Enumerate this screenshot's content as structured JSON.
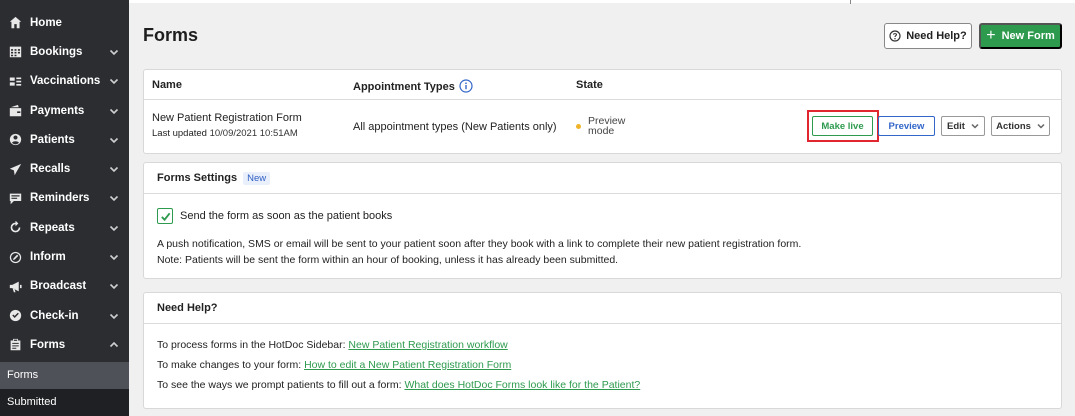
{
  "sidebar": {
    "items": [
      {
        "label": "Home",
        "icon": "home-icon",
        "chevron": false
      },
      {
        "label": "Bookings",
        "icon": "calendar-icon",
        "chevron": "down"
      },
      {
        "label": "Vaccinations",
        "icon": "syringe-icon",
        "chevron": "down"
      },
      {
        "label": "Payments",
        "icon": "wallet-icon",
        "chevron": "down"
      },
      {
        "label": "Patients",
        "icon": "user-circle-icon",
        "chevron": "down"
      },
      {
        "label": "Recalls",
        "icon": "send-icon",
        "chevron": "down"
      },
      {
        "label": "Reminders",
        "icon": "message-icon",
        "chevron": "down"
      },
      {
        "label": "Repeats",
        "icon": "repeat-icon",
        "chevron": "down"
      },
      {
        "label": "Inform",
        "icon": "pen-circle-icon",
        "chevron": "down"
      },
      {
        "label": "Broadcast",
        "icon": "megaphone-icon",
        "chevron": "down"
      },
      {
        "label": "Check-in",
        "icon": "check-circle-icon",
        "chevron": "down"
      },
      {
        "label": "Forms",
        "icon": "clipboard-icon",
        "chevron": "up"
      }
    ],
    "sub_items": [
      {
        "label": "Forms",
        "active": true
      },
      {
        "label": "Submitted",
        "active": false
      }
    ]
  },
  "header": {
    "title": "Forms",
    "help_button": "Need Help?",
    "new_button": "New Form"
  },
  "table": {
    "columns": [
      "Name",
      "Appointment Types",
      "State"
    ],
    "rows": [
      {
        "name": "New Patient Registration Form",
        "updated_label": "Last updated",
        "updated_value": "10/09/2021 10:51AM",
        "appointment_types": "All appointment types (New Patients only)",
        "state_line1": "Preview",
        "state_line2": "mode",
        "actions": {
          "make_live": "Make live",
          "preview": "Preview",
          "edit": "Edit",
          "more": "Actions"
        }
      }
    ]
  },
  "settings": {
    "title": "Forms Settings",
    "badge": "New",
    "checkbox_label": "Send the form as soon as the patient books",
    "checked": true,
    "note1": "A push notification, SMS or email will be sent to your patient soon after they book with a link to complete their new patient registration form.",
    "note2": "Note: Patients will be sent the form within an hour of booking, unless it has already been submitted."
  },
  "help": {
    "title": "Need Help?",
    "lines": [
      {
        "text": "To process forms in the HotDoc Sidebar: ",
        "link": "New Patient Registration workflow"
      },
      {
        "text": "To make changes to your form: ",
        "link": "How to edit a New Patient Registration Form"
      },
      {
        "text": "To see the ways we prompt patients to fill out a form: ",
        "link": "What does HotDoc Forms look like for the Patient?"
      }
    ]
  },
  "colors": {
    "sidebar_bg": "#2b2d31",
    "accent_green": "#2e9a4e",
    "link_blue": "#3266c9",
    "highlight_red": "#e0262e",
    "state_dot": "#f0b429"
  }
}
